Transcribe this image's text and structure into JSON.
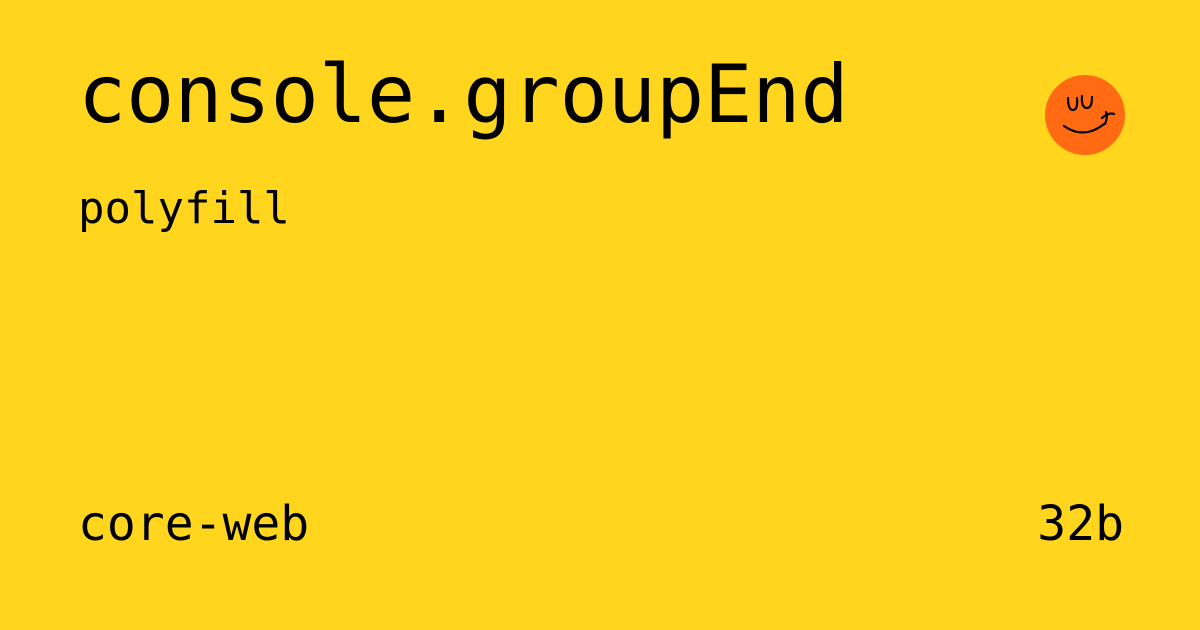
{
  "card": {
    "title": "console.groupEnd",
    "subtitle": "polyfill",
    "package": "core-web",
    "size": "32b"
  },
  "logo": {
    "icon": "smiley-face-icon",
    "color": "#FF6A13"
  },
  "colors": {
    "background": "#FFD51E",
    "text": "#000000"
  }
}
